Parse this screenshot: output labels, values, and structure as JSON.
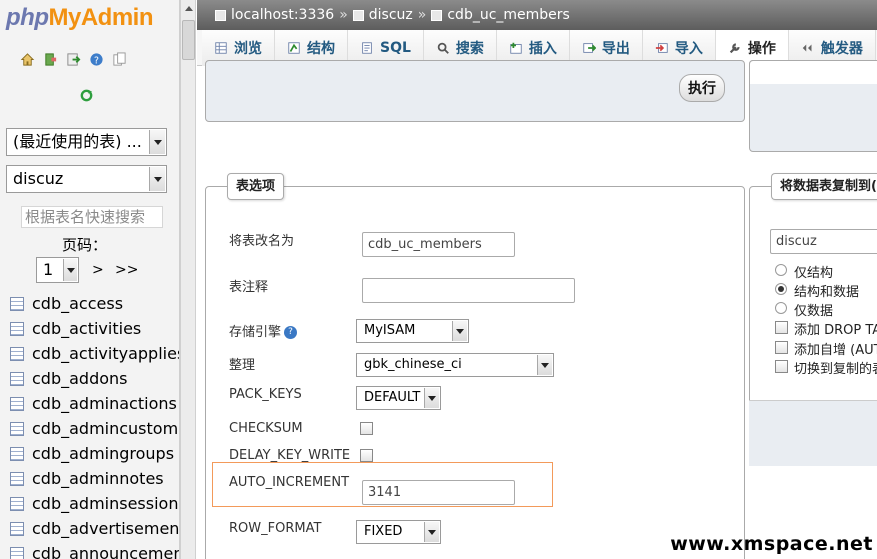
{
  "logo": {
    "php": "php",
    "myadmin": "MyAdmin"
  },
  "sidebar": {
    "recent_tables": "(最近使用的表) ...",
    "database": "discuz",
    "quick_search_placeholder": "根据表名快速搜索",
    "page_label": "页码：",
    "page_value": "1",
    "next": ">",
    "last": ">>",
    "tables": [
      "cdb_access",
      "cdb_activities",
      "cdb_activityapplies",
      "cdb_addons",
      "cdb_adminactions",
      "cdb_admincustom",
      "cdb_admingroups",
      "cdb_adminnotes",
      "cdb_adminsessions",
      "cdb_advertisements",
      "cdb_announcements"
    ]
  },
  "breadcrumb": {
    "server": "localhost:3336",
    "database": "discuz",
    "table": "cdb_uc_members",
    "sep": "»"
  },
  "tabs": [
    {
      "label": "浏览",
      "icon": "browse-icon"
    },
    {
      "label": "结构",
      "icon": "structure-icon"
    },
    {
      "label": "SQL",
      "icon": "sql-icon"
    },
    {
      "label": "搜索",
      "icon": "search-icon"
    },
    {
      "label": "插入",
      "icon": "insert-icon"
    },
    {
      "label": "导出",
      "icon": "export-icon"
    },
    {
      "label": "导入",
      "icon": "import-icon"
    },
    {
      "label": "操作",
      "icon": "wrench-icon"
    },
    {
      "label": "触发器",
      "icon": "triggers-icon"
    }
  ],
  "execute_label": "执行",
  "table_options": {
    "legend": "表选项",
    "rename_label": "将表改名为",
    "rename_value": "cdb_uc_members",
    "comment_label": "表注释",
    "comment_value": "",
    "engine_label": "存储引擎",
    "engine_value": "MyISAM",
    "collation_label": "整理",
    "collation_value": "gbk_chinese_ci",
    "pack_keys_label": "PACK_KEYS",
    "pack_keys_value": "DEFAULT",
    "checksum_label": "CHECKSUM",
    "delay_key_write_label": "DELAY_KEY_WRITE",
    "auto_increment_label": "AUTO_INCREMENT",
    "auto_increment_value": "3141",
    "row_format_label": "ROW_FORMAT",
    "row_format_value": "FIXED"
  },
  "copy_table": {
    "legend": "将数据表复制到(",
    "database": "discuz",
    "options": [
      "仅结构",
      "结构和数据",
      "仅数据"
    ],
    "selected": "结构和数据",
    "checks": [
      "添加 DROP TA",
      "添加自增 (AUT",
      "切换到复制的表"
    ]
  },
  "watermark": "www.xmspace.net"
}
